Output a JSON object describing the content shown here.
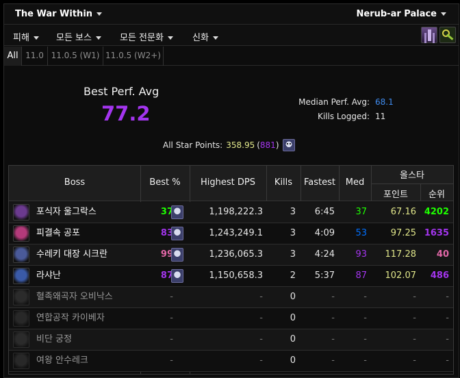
{
  "header": {
    "expansion": "The War Within",
    "raid": "Nerub-ar Palace"
  },
  "menu": {
    "items": [
      "피해",
      "모든 보스",
      "모든 전문화",
      "신화"
    ]
  },
  "tabs": [
    "All",
    "11.0",
    "11.0.5 (W1)",
    "11.0.5 (W2+)"
  ],
  "summary": {
    "best_label": "Best Perf. Avg",
    "best_value": "77.2",
    "median_label": "Median Perf. Avg:",
    "median_value": "68.1",
    "kills_label": "Kills Logged:",
    "kills_value": "11",
    "star_label": "All Star Points:",
    "star_points": "358.95",
    "star_rank_open": "(",
    "star_rank": "881",
    "star_rank_close": ")"
  },
  "table": {
    "headers": {
      "boss": "Boss",
      "best": "Best %",
      "dps": "Highest DPS",
      "kills": "Kills",
      "fastest": "Fastest",
      "med": "Med",
      "allstar": "올스타",
      "points": "포인트",
      "rank": "순위"
    },
    "rows": [
      {
        "boss": "포식자 울그락스",
        "best": "37",
        "dps": "1,198,222.3",
        "kills": "3",
        "fastest": "6:45",
        "med": "37",
        "points": "67.16",
        "rank": "4202",
        "best_color": "#1eff00",
        "med_color": "#1eff00",
        "rank_color": "#1eff00",
        "active": true,
        "icon_color": "#6b3a8f"
      },
      {
        "boss": "피결속 공포",
        "best": "83",
        "dps": "1,243,249.1",
        "kills": "3",
        "fastest": "4:09",
        "med": "53",
        "points": "97.25",
        "rank": "1635",
        "best_color": "#a335ee",
        "med_color": "#0070ff",
        "rank_color": "#a335ee",
        "active": true,
        "icon_color": "#b33a7a"
      },
      {
        "boss": "수레키 대장 시크란",
        "best": "99",
        "dps": "1,236,065.3",
        "kills": "3",
        "fastest": "4:24",
        "med": "93",
        "points": "117.28",
        "rank": "40",
        "best_color": "#e268a8",
        "med_color": "#a335ee",
        "rank_color": "#e268a8",
        "active": true,
        "icon_color": "#4a5a9a"
      },
      {
        "boss": "라샤난",
        "best": "87",
        "dps": "1,150,658.3",
        "kills": "2",
        "fastest": "5:37",
        "med": "87",
        "points": "102.07",
        "rank": "486",
        "best_color": "#a335ee",
        "med_color": "#a335ee",
        "rank_color": "#a335ee",
        "active": true,
        "icon_color": "#3a5aa8"
      },
      {
        "boss": "혈족왜곡자 오비낙스",
        "best": "-",
        "dps": "-",
        "kills": "0",
        "fastest": "-",
        "med": "-",
        "points": "-",
        "rank": "-",
        "active": false,
        "icon_color": "#3a3a3a"
      },
      {
        "boss": "연합공작 카이베자",
        "best": "-",
        "dps": "-",
        "kills": "0",
        "fastest": "-",
        "med": "-",
        "points": "-",
        "rank": "-",
        "active": false,
        "icon_color": "#3a3a3a"
      },
      {
        "boss": "비단 궁정",
        "best": "-",
        "dps": "-",
        "kills": "0",
        "fastest": "-",
        "med": "-",
        "points": "-",
        "rank": "-",
        "active": false,
        "icon_color": "#3a3a3a"
      },
      {
        "boss": "여왕 안수레크",
        "best": "-",
        "dps": "-",
        "kills": "0",
        "fastest": "-",
        "med": "-",
        "points": "-",
        "rank": "-",
        "active": false,
        "icon_color": "#3a3a3a"
      }
    ]
  }
}
